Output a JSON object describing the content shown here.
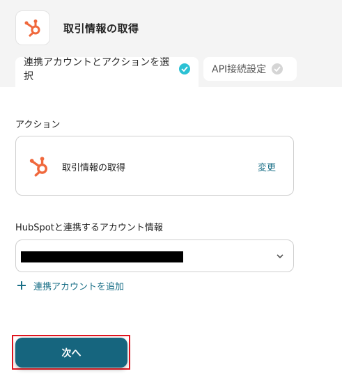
{
  "header": {
    "app_icon": "hubspot-icon",
    "title": "取引情報の取得"
  },
  "tabs": [
    {
      "label": "連携アカウントとアクションを選択",
      "state": "active",
      "check_color": "#2bc1d4"
    },
    {
      "label": "API接続設定",
      "state": "inactive",
      "check_color": "#d5d5d5"
    }
  ],
  "action": {
    "section_label": "アクション",
    "icon": "hubspot-icon",
    "name": "取引情報の取得",
    "change_label": "変更"
  },
  "account": {
    "section_label": "HubSpotと連携するアカウント情報",
    "selected_value_redacted": true,
    "add_label": "連携アカウントを追加"
  },
  "footer": {
    "next_label": "次へ"
  },
  "colors": {
    "accent": "#16657e",
    "hubspot_orange": "#f0683c",
    "highlight": "#e0141e"
  }
}
